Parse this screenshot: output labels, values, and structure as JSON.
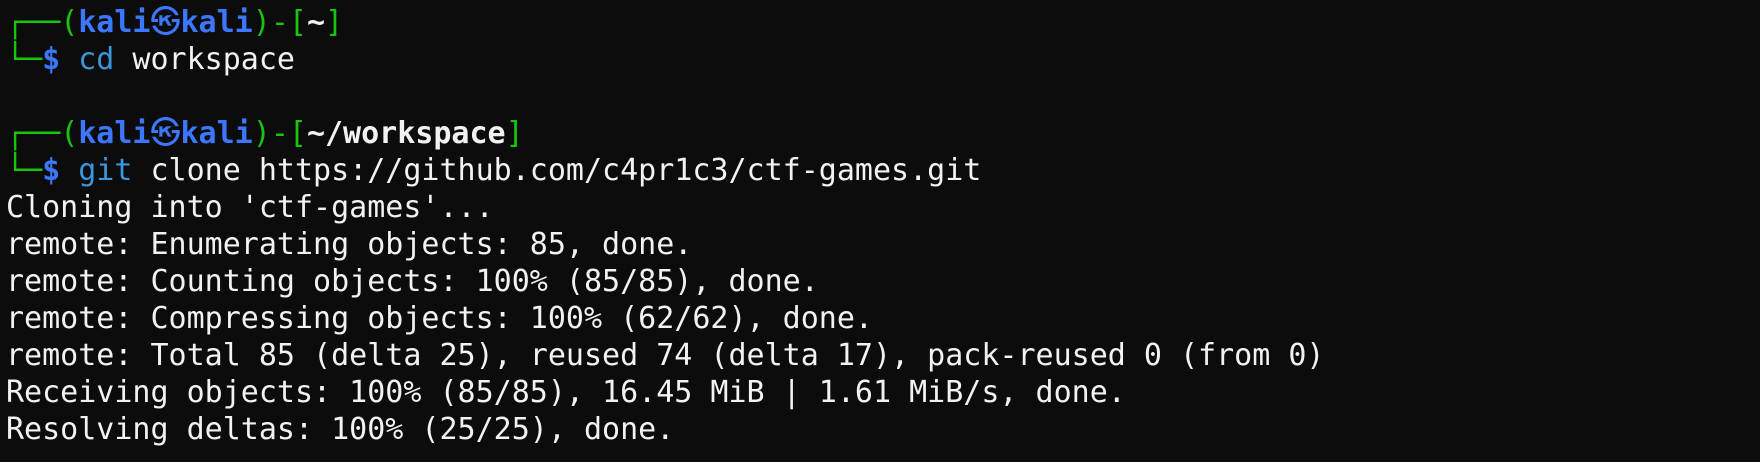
{
  "prompt_parts": {
    "corner_top": "┌──",
    "open_paren": "(",
    "user": "kali",
    "at_symbol": "㉿",
    "host": "kali",
    "close_paren": ")",
    "dash": "-",
    "open_bracket": "[",
    "close_bracket": "]",
    "corner_bottom": "└─",
    "dollar": "$"
  },
  "blocks": [
    {
      "path": "~",
      "command": "cd",
      "args": " workspace"
    },
    {
      "path": "~/workspace",
      "command": "git",
      "args": " clone https://github.com/c4pr1c3/ctf-games.git"
    }
  ],
  "output": [
    "Cloning into 'ctf-games'...",
    "remote: Enumerating objects: 85, done.",
    "remote: Counting objects: 100% (85/85), done.",
    "remote: Compressing objects: 100% (62/62), done.",
    "remote: Total 85 (delta 25), reused 74 (delta 17), pack-reused 0 (from 0)",
    "Receiving objects: 100% (85/85), 16.45 MiB | 1.61 MiB/s, done.",
    "Resolving deltas: 100% (25/25), done."
  ]
}
